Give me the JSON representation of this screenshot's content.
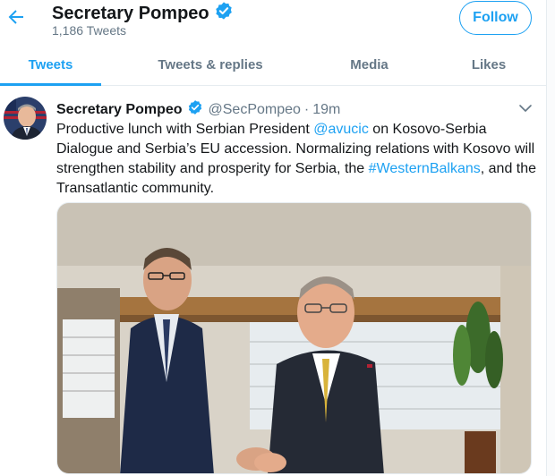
{
  "header": {
    "name": "Secretary Pompeo",
    "tweet_count": "1,186 Tweets",
    "follow_label": "Follow"
  },
  "tabs": [
    {
      "label": "Tweets",
      "active": true
    },
    {
      "label": "Tweets & replies",
      "active": false
    },
    {
      "label": "Media",
      "active": false
    },
    {
      "label": "Likes",
      "active": false
    }
  ],
  "tweet": {
    "name": "Secretary Pompeo",
    "handle": "@SecPompeo",
    "separator": "·",
    "time": "19m",
    "text_1": "Productive lunch with Serbian President ",
    "mention": "@avucic",
    "text_2": " on Kosovo-Serbia Dialogue and Serbia’s EU accession. Normalizing relations with Kosovo will strengthen stability and prosperity for Serbia, the ",
    "hashtag": "#WesternBalkans",
    "text_3": ", and the Transatlantic community."
  },
  "colors": {
    "accent": "#1da1f2",
    "secondary_text": "#657786",
    "border": "#e6ecf0"
  },
  "icons": {
    "back": "back-arrow-icon",
    "verified": "verified-badge-icon",
    "caret": "chevron-down-icon"
  }
}
